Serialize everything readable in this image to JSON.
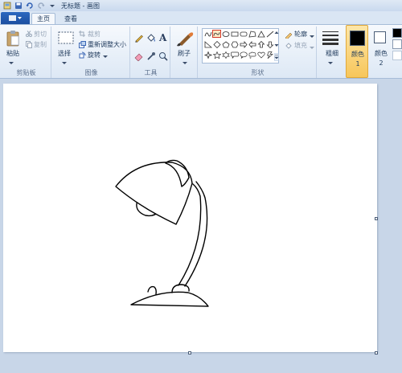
{
  "titlebar": {
    "title": "无标题 - 画图"
  },
  "tabs": {
    "home": "主页",
    "view": "查看"
  },
  "clipboard": {
    "paste": "粘贴",
    "cut": "剪切",
    "copy": "复制",
    "label": "剪贴板"
  },
  "image": {
    "select": "选择",
    "crop": "裁剪",
    "resize": "重新调整大小",
    "rotate": "旋转",
    "label": "图像"
  },
  "tools": {
    "label": "工具"
  },
  "brushes": {
    "label": "刷子"
  },
  "shapes": {
    "outline": "轮廓",
    "fill": "填充",
    "label": "形状"
  },
  "size": {
    "label": "粗细"
  },
  "colors": {
    "color1": "颜色 1",
    "color2": "颜色 2",
    "color1_value": "#000000",
    "color2_value": "#ffffff"
  },
  "accent": "#2c68c0"
}
